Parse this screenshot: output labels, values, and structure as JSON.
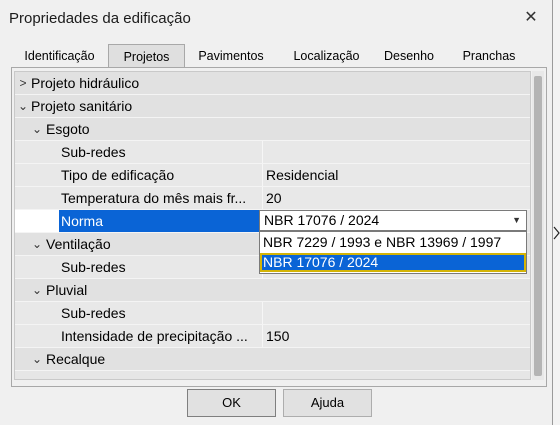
{
  "window": {
    "title": "Propriedades da edificação"
  },
  "tabs": [
    {
      "label": "Identificação",
      "active": false
    },
    {
      "label": "Projetos",
      "active": true
    },
    {
      "label": "Pavimentos",
      "active": false
    },
    {
      "label": "Localização",
      "active": false
    },
    {
      "label": "Desenho",
      "active": false
    },
    {
      "label": "Pranchas",
      "active": false
    }
  ],
  "grid": {
    "rows": [
      {
        "kind": "category",
        "label": "Projeto hidráulico",
        "expanded": false
      },
      {
        "kind": "category",
        "label": "Projeto sanitário",
        "expanded": true
      },
      {
        "kind": "category",
        "label": "Esgoto",
        "expanded": true
      },
      {
        "kind": "property",
        "label": "Sub-redes",
        "value": ""
      },
      {
        "kind": "property",
        "label": "Tipo de edificação",
        "value": "Residencial"
      },
      {
        "kind": "property",
        "label": "Temperatura do mês mais fr...",
        "value": "20"
      },
      {
        "kind": "property",
        "label": "Norma",
        "value": "NBR 17076 / 2024",
        "selected": true
      },
      {
        "kind": "category",
        "label": "Ventilação",
        "expanded": true
      },
      {
        "kind": "property",
        "label": "Sub-redes",
        "value": ""
      },
      {
        "kind": "category",
        "label": "Pluvial",
        "expanded": true
      },
      {
        "kind": "property",
        "label": "Sub-redes",
        "value": ""
      },
      {
        "kind": "property",
        "label": "Intensidade de precipitação ...",
        "value": "150"
      },
      {
        "kind": "category",
        "label": "Recalque",
        "expanded": true
      }
    ]
  },
  "norma_combo": {
    "value": "NBR 17076 / 2024",
    "options": [
      {
        "label": "NBR 7229 / 1993 e NBR 13969 / 1997",
        "highlighted": false
      },
      {
        "label": "NBR 17076 / 2024",
        "highlighted": true
      }
    ]
  },
  "buttons": {
    "ok": "OK",
    "help": "Ajuda"
  },
  "colors": {
    "selection": "#0a64d6",
    "focus_outline": "#d4b406"
  }
}
